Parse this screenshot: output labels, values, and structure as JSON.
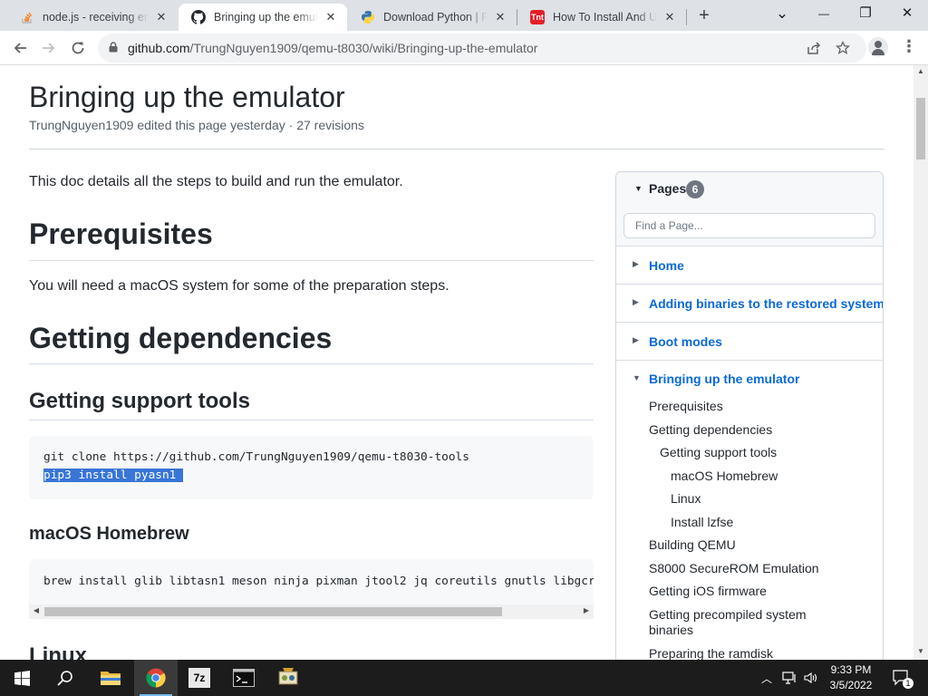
{
  "browser": {
    "tabs": [
      {
        "title": "node.js - receiving error",
        "favicon": "stackoverflow-icon",
        "active": false
      },
      {
        "title": "Bringing up the emulator",
        "favicon": "github-icon",
        "active": true
      },
      {
        "title": "Download Python | Python",
        "favicon": "python-icon",
        "active": false
      },
      {
        "title": "How To Install And Use",
        "favicon": "tnt-icon",
        "favicon_text": "Tnt",
        "active": false
      }
    ],
    "new_tab": "+",
    "window_controls": {
      "tab_search": "⌄",
      "minimize": "—",
      "restore": "❐",
      "close": "✕"
    },
    "url_host": "github.com",
    "url_path": "/TrungNguyen1909/qemu-t8030/wiki/Bringing-up-the-emulator"
  },
  "page": {
    "title": "Bringing up the emulator",
    "meta": "TrungNguyen1909 edited this page yesterday · 27 revisions",
    "intro": "This doc details all the steps to build and run the emulator.",
    "h_prerequisites": "Prerequisites",
    "p_prerequisites": "You will need a macOS system for some of the preparation steps.",
    "h_dependencies": "Getting dependencies",
    "h_support_tools": "Getting support tools",
    "code_support_tools": [
      "git clone https://github.com/TrungNguyen1909/qemu-t8030-tools",
      "pip3 install pyasn1"
    ],
    "h_homebrew": "macOS Homebrew",
    "code_homebrew": "brew install glib libtasn1 meson ninja pixman jtool2 jq coreutils gnutls libgcryp",
    "h_linux": "Linux"
  },
  "sidebar": {
    "title": "Pages",
    "count": "6",
    "search_placeholder": "Find a Page...",
    "pages": [
      "Home",
      "Adding binaries to the restored system",
      "Boot modes",
      "Bringing up the emulator"
    ],
    "toc": [
      {
        "label": "Prerequisites",
        "level": 0
      },
      {
        "label": "Getting dependencies",
        "level": 0
      },
      {
        "label": "Getting support tools",
        "level": 1
      },
      {
        "label": "macOS Homebrew",
        "level": 2
      },
      {
        "label": "Linux",
        "level": 2
      },
      {
        "label": "Install lzfse",
        "level": 2
      },
      {
        "label": "Building QEMU",
        "level": 0
      },
      {
        "label": "S8000 SecureROM Emulation",
        "level": 0
      },
      {
        "label": "Getting iOS firmware",
        "level": 0
      },
      {
        "label": "Getting precompiled system binaries",
        "level": 0
      },
      {
        "label": "Preparing the ramdisk",
        "level": 0
      }
    ]
  },
  "taskbar": {
    "apps": [
      "start-icon",
      "search-icon",
      "file-explorer-icon",
      "chrome-icon",
      "7zip-icon",
      "terminal-icon",
      "app-icon"
    ],
    "label_7z": "7z",
    "time": "9:33 PM",
    "date": "3/5/2022",
    "notifications": "1"
  },
  "colors": {
    "link": "#0969da",
    "selection": "#3875d7",
    "chrome_tabstrip": "#dee1e6"
  }
}
